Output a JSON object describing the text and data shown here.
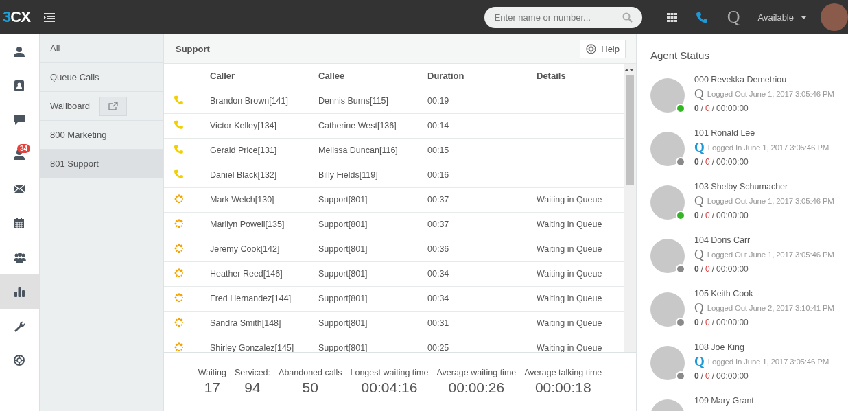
{
  "topbar": {
    "logo": "3CX",
    "search": {
      "placeholder": "Enter name or number..."
    },
    "queue_label": "Q",
    "status": "Available"
  },
  "rail": [
    {
      "selected": false
    },
    {
      "selected": false
    },
    {
      "selected": false
    },
    {
      "selected": false,
      "badge": "34"
    },
    {
      "selected": false
    },
    {
      "selected": false
    },
    {
      "selected": false
    },
    {
      "selected": true
    },
    {
      "selected": false
    },
    {
      "selected": false
    }
  ],
  "nav": [
    {
      "label": "All",
      "selected": false
    },
    {
      "label": "Queue Calls",
      "selected": false
    },
    {
      "label": "Wallboard",
      "selected": false,
      "action": true
    },
    {
      "label": "800 Marketing",
      "selected": false
    },
    {
      "label": "801 Support",
      "selected": true
    }
  ],
  "main": {
    "title": "Support",
    "help": "Help",
    "table": {
      "columns": [
        "Caller",
        "Callee",
        "Duration",
        "Details"
      ],
      "rows": [
        {
          "kind": "talking",
          "caller": "Brandon Brown[141]",
          "callee": "Dennis Burns[115]",
          "duration": "00:19"
        },
        {
          "kind": "talking",
          "caller": "Victor Kelley[134]",
          "callee": "Catherine West[136]",
          "duration": "00:14"
        },
        {
          "kind": "talking",
          "caller": "Gerald Price[131]",
          "callee": "Melissa Duncan[116]",
          "duration": "00:15"
        },
        {
          "kind": "talking",
          "caller": "Daniel Black[132]",
          "callee": "Billy Fields[119]",
          "duration": "00:16"
        },
        {
          "kind": "waiting",
          "caller": "Mark Welch[130]",
          "callee": "Support[801]",
          "duration": "00:37",
          "details": "Waiting in Queue"
        },
        {
          "kind": "waiting",
          "caller": "Marilyn Powell[135]",
          "callee": "Support[801]",
          "duration": "00:37",
          "details": "Waiting in Queue"
        },
        {
          "kind": "waiting",
          "caller": "Jeremy Cook[142]",
          "callee": "Support[801]",
          "duration": "00:36",
          "details": "Waiting in Queue"
        },
        {
          "kind": "waiting",
          "caller": "Heather Reed[146]",
          "callee": "Support[801]",
          "duration": "00:34",
          "details": "Waiting in Queue"
        },
        {
          "kind": "waiting",
          "caller": "Fred Hernandez[144]",
          "callee": "Support[801]",
          "duration": "00:34",
          "details": "Waiting in Queue"
        },
        {
          "kind": "waiting",
          "caller": "Sandra Smith[148]",
          "callee": "Support[801]",
          "duration": "00:31",
          "details": "Waiting in Queue"
        },
        {
          "kind": "waiting",
          "caller": "Shirley Gonzalez[145]",
          "callee": "Support[801]",
          "duration": "00:25",
          "details": "Waiting in Queue"
        }
      ]
    },
    "stats": [
      {
        "label": "Waiting",
        "value": "17"
      },
      {
        "label": "Serviced:",
        "value": "94"
      },
      {
        "label": "Abandoned calls",
        "value": "50"
      },
      {
        "label": "Longest waiting time",
        "value": "00:04:16"
      },
      {
        "label": "Average waiting time",
        "value": "00:00:26"
      },
      {
        "label": "Average talking time",
        "value": "00:00:18"
      }
    ]
  },
  "agent_panel": {
    "title": "Agent Status",
    "separator": "/",
    "agents": [
      {
        "name": "000 Revekka Demetriou",
        "color": "#33b524",
        "queue_label": "Q",
        "logged_in": false,
        "login": "Logged Out June 1, 2017 3:05:46 PM",
        "answered": "0",
        "missed": "0",
        "time": "00:00:00"
      },
      {
        "name": "101 Ronald Lee",
        "color": "#8a8a8a",
        "queue_label": "Q",
        "logged_in": true,
        "login": "Logged In June 1, 2017 3:05:46 PM",
        "answered": "0",
        "missed": "0",
        "time": "00:00:00"
      },
      {
        "name": "103 Shelby Schumacher",
        "color": "#33b524",
        "queue_label": "Q",
        "logged_in": false,
        "login": "Logged Out June 1, 2017 3:05:46 PM",
        "answered": "0",
        "missed": "0",
        "time": "00:00:00"
      },
      {
        "name": "104 Doris Carr",
        "color": "#8a8a8a",
        "queue_label": "Q",
        "logged_in": false,
        "login": "Logged Out June 1, 2017 3:05:46 PM",
        "answered": "0",
        "missed": "0",
        "time": "00:00:00"
      },
      {
        "name": "105 Keith Cook",
        "color": "#8a8a8a",
        "queue_label": "Q",
        "logged_in": false,
        "login": "Logged Out June 2, 2017 3:10:41 PM",
        "answered": "0",
        "missed": "0",
        "time": "00:00:00"
      },
      {
        "name": "108 Joe King",
        "color": "#8a8a8a",
        "queue_label": "Q",
        "logged_in": true,
        "login": "Logged In June 1, 2017 3:05:46 PM",
        "answered": "0",
        "missed": "0",
        "time": "00:00:00"
      },
      {
        "name": "109 Mary Grant"
      }
    ]
  }
}
